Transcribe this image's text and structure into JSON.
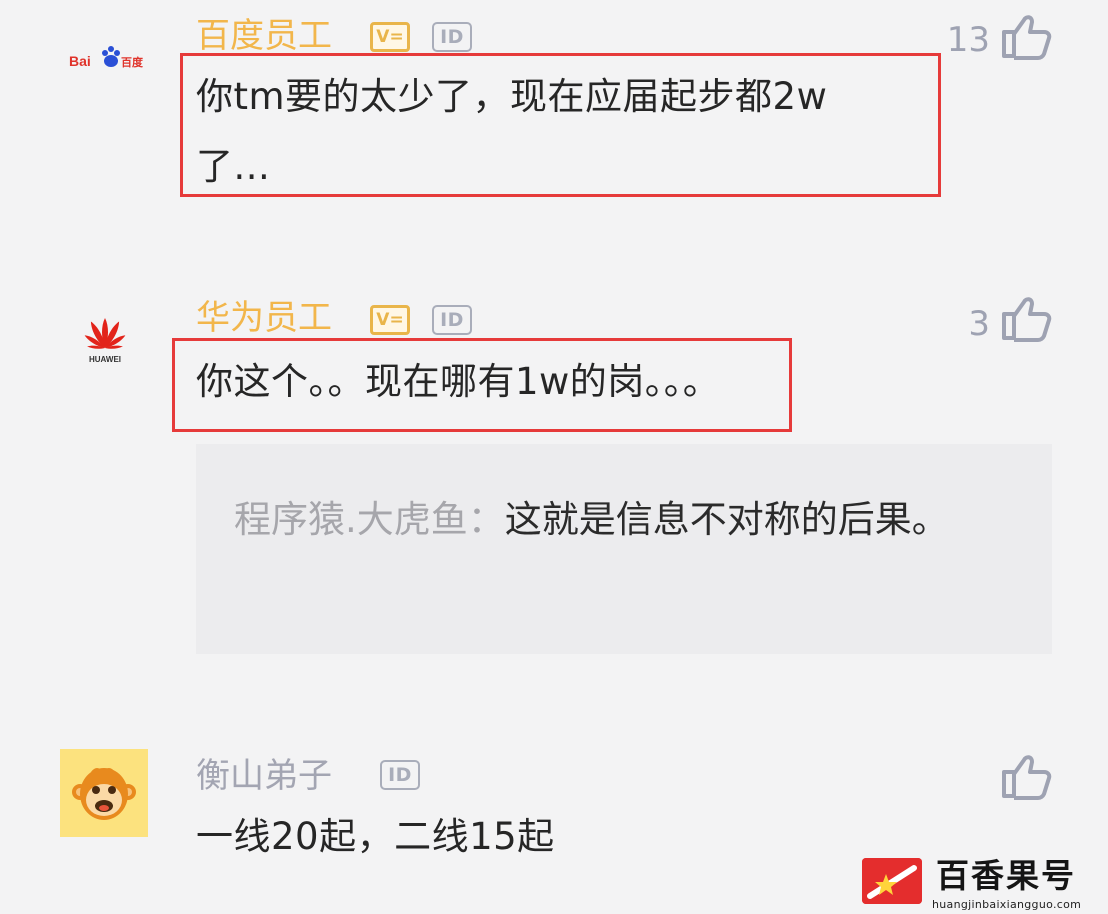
{
  "comments": [
    {
      "avatar": "baidu-logo",
      "avatar_text": "Bai百度",
      "username": "百度员工",
      "badges": [
        "V=",
        "ID"
      ],
      "likes": "13",
      "text_lines": [
        "你tm要的太少了，现在应届起步都2w",
        "了..."
      ]
    },
    {
      "avatar": "huawei-logo",
      "avatar_text": "HUAWEI",
      "username": "华为员工",
      "badges": [
        "V=",
        "ID"
      ],
      "likes": "3",
      "text_lines": [
        "你这个。。现在哪有1w的岗。。。"
      ],
      "reply": {
        "author": "程序猿.大虎鱼：",
        "text": "这就是信息不对称的后果。"
      }
    },
    {
      "avatar": "monkey-avatar",
      "username": "衡山弟子",
      "badges": [
        "ID"
      ],
      "likes": "",
      "text_lines": [
        "一线20起，二线15起"
      ]
    }
  ],
  "watermark": {
    "name": "百香果号",
    "url": "huangjinbaixiangguo.com"
  },
  "colors": {
    "vip_username": "#f2b64b",
    "normal_username": "#a3a5b2",
    "highlight": "#e63a3a",
    "icon": "#9ea2b2"
  }
}
